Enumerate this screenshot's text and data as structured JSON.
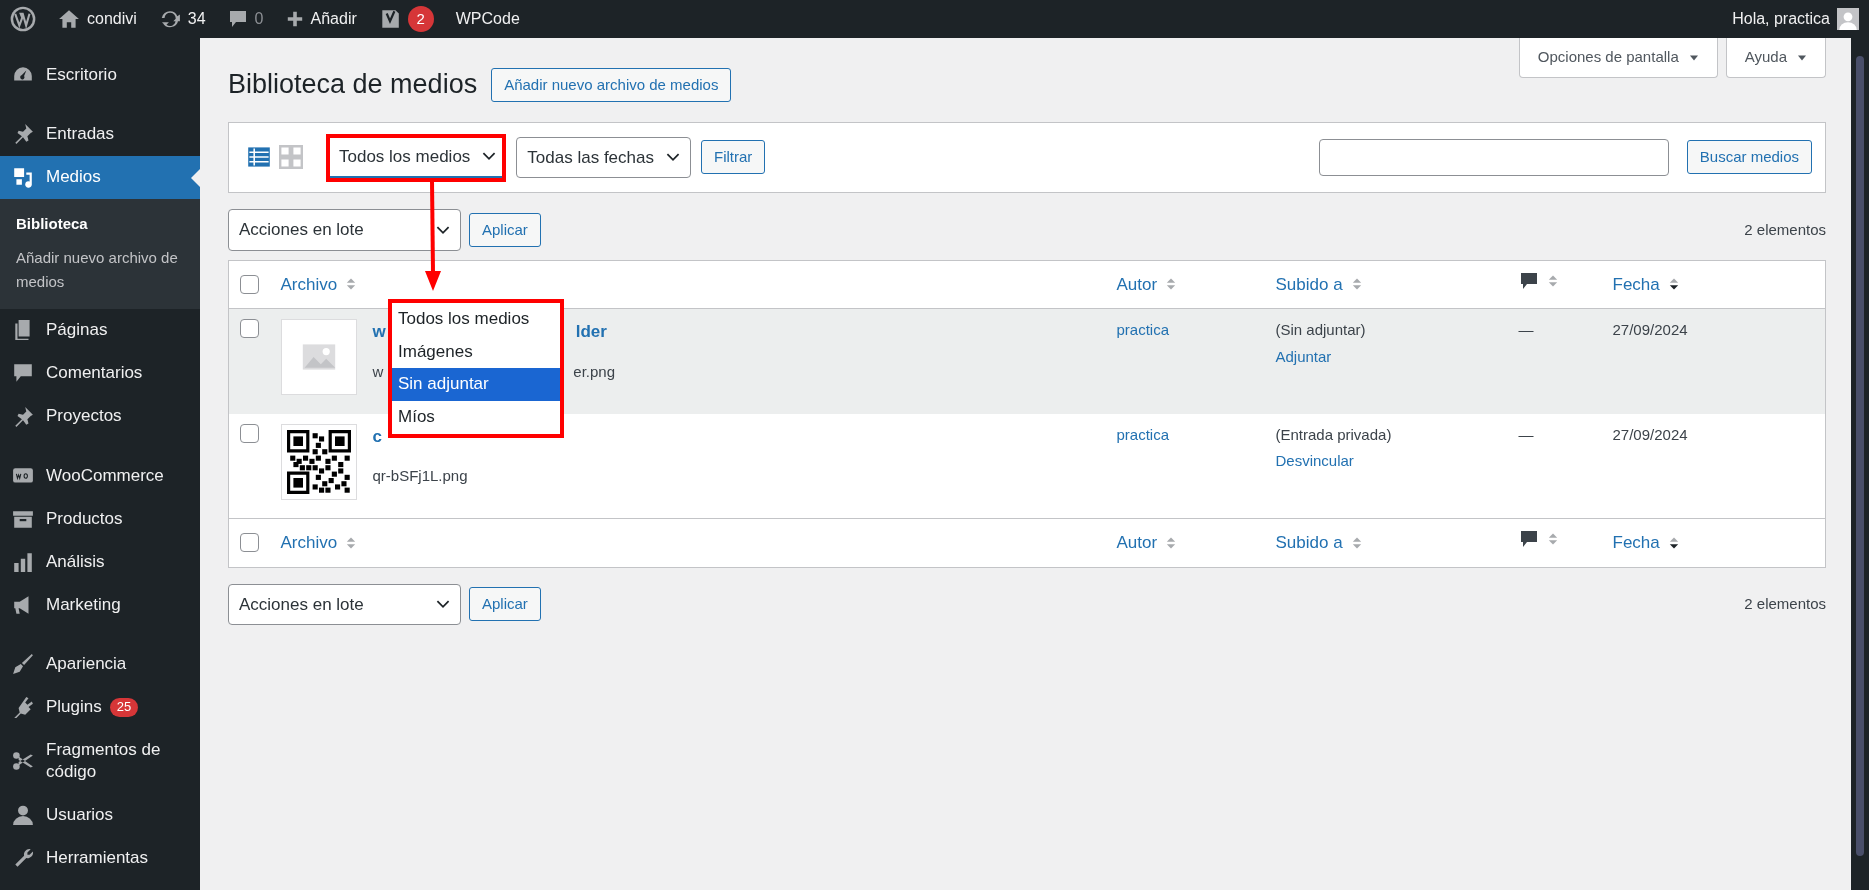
{
  "admin_bar": {
    "site": "condivi",
    "updates": "34",
    "comments": "0",
    "new": "Añadir",
    "seo_badge": "2",
    "plugin": "WPCode",
    "greeting": "Hola, practica"
  },
  "sidebar": {
    "groups": [
      [
        {
          "label": "Escritorio",
          "selected": false
        }
      ],
      [
        {
          "label": "Entradas",
          "selected": false
        },
        {
          "label": "Medios",
          "selected": true,
          "children": [
            {
              "label": "Biblioteca",
              "selected": true
            },
            {
              "label": "Añadir nuevo archivo de medios",
              "selected": false
            }
          ]
        },
        {
          "label": "Páginas",
          "selected": false
        },
        {
          "label": "Comentarios",
          "selected": false
        },
        {
          "label": "Proyectos",
          "selected": false
        }
      ],
      [
        {
          "label": "WooCommerce",
          "selected": false
        },
        {
          "label": "Productos",
          "selected": false
        },
        {
          "label": "Análisis",
          "selected": false
        },
        {
          "label": "Marketing",
          "selected": false
        }
      ],
      [
        {
          "label": "Apariencia",
          "selected": false
        },
        {
          "label": "Plugins",
          "selected": false,
          "badge": "25"
        },
        {
          "label": "Fragmentos de código",
          "selected": false
        },
        {
          "label": "Usuarios",
          "selected": false
        },
        {
          "label": "Herramientas",
          "selected": false
        }
      ]
    ]
  },
  "page": {
    "title": "Biblioteca de medios",
    "add_button": "Añadir nuevo archivo de medios",
    "screen_options": "Opciones de pantalla",
    "help": "Ayuda"
  },
  "filters": {
    "views": [
      {
        "kind": "list",
        "selected": true
      },
      {
        "kind": "grid",
        "selected": false
      }
    ],
    "type_select": "Todos los medios",
    "date_select": "Todas las fechas",
    "filter_button": "Filtrar",
    "search_button": "Buscar medios"
  },
  "dropdown": {
    "options": [
      {
        "label": "Todos los medios",
        "selected": false
      },
      {
        "label": "Imágenes",
        "selected": false
      },
      {
        "label": "Sin adjuntar",
        "selected": true
      },
      {
        "label": "Míos",
        "selected": false
      }
    ]
  },
  "bulk_top": {
    "select": "Acciones en lote",
    "apply": "Aplicar",
    "count": "2 elementos"
  },
  "table": {
    "header_checked": false,
    "footer_checked": false,
    "columns": [
      {
        "kind": "text",
        "label": "Archivo",
        "sorted_desc": false
      },
      {
        "kind": "text",
        "label": "Autor",
        "sorted_desc": false
      },
      {
        "kind": "text",
        "label": "Subido a",
        "sorted_desc": false
      },
      {
        "kind": "comments",
        "sorted_desc": false
      },
      {
        "kind": "text",
        "label": "Fecha",
        "sorted_desc": true
      }
    ],
    "rows": [
      {
        "checked": false,
        "highlighted": true,
        "thumbnail": {
          "kind": "placeholder"
        },
        "title_parts": [
          "w",
          "lder"
        ],
        "filename_parts": [
          "w",
          "er.png"
        ],
        "author": "practica",
        "uploaded_to": "(Sin adjuntar)",
        "action": "Adjuntar",
        "comments": "—",
        "date": "27/09/2024"
      },
      {
        "checked": false,
        "highlighted": false,
        "thumbnail": {
          "kind": "qr"
        },
        "title_parts": [
          "c"
        ],
        "filename_parts": [
          "qr-bSFj1L.png"
        ],
        "author": "practica",
        "uploaded_to": "(Entrada privada)",
        "action": "Desvincular",
        "comments": "—",
        "date": "27/09/2024"
      }
    ],
    "footer_columns": [
      {
        "kind": "text",
        "label": "Archivo",
        "sorted_desc": false
      },
      {
        "kind": "text",
        "label": "Autor",
        "sorted_desc": false
      },
      {
        "kind": "text",
        "label": "Subido a",
        "sorted_desc": false
      },
      {
        "kind": "comments",
        "sorted_desc": false
      },
      {
        "kind": "text",
        "label": "Fecha",
        "sorted_desc": true
      }
    ]
  },
  "bulk_bottom": {
    "select": "Acciones en lote",
    "apply": "Aplicar",
    "count": "2 elementos"
  }
}
